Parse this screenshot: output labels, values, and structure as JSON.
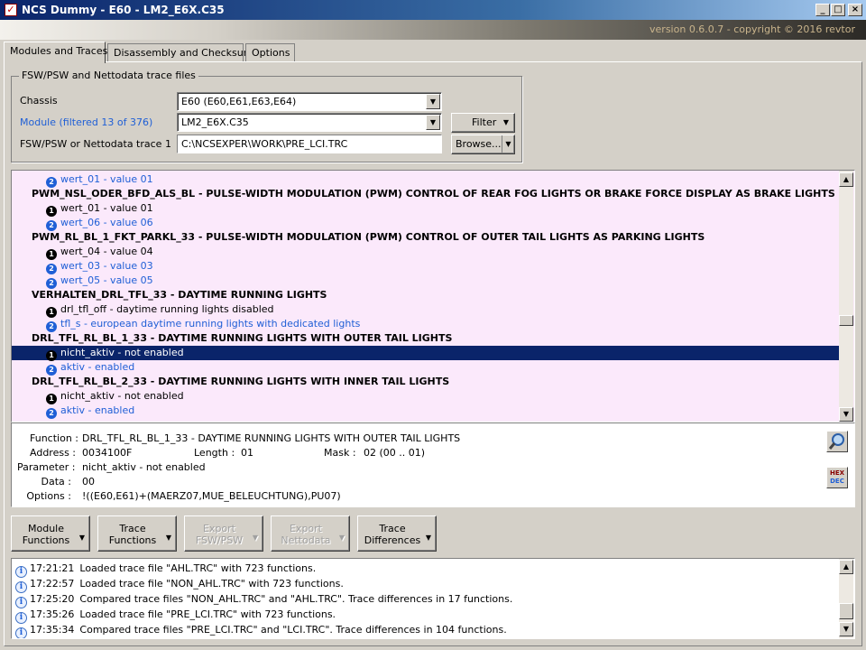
{
  "window": {
    "title": "NCS Dummy - E60 - LM2_E6X.C35",
    "version": "version 0.6.0.7 - copyright © 2016 revtor"
  },
  "tabs": [
    "Modules and Traces",
    "Disassembly and Checksums",
    "Options"
  ],
  "files": {
    "legend": "FSW/PSW and Nettodata trace files",
    "chassis_label": "Chassis",
    "chassis_value": "E60  (E60,E61,E63,E64)",
    "module_label": "Module (filtered 13 of 376)",
    "module_value": "LM2_E6X.C35",
    "trace_label": "FSW/PSW or Nettodata trace 1",
    "trace_value": "C:\\NCSEXPER\\WORK\\PRE_LCI.TRC",
    "filter_button": "Filter",
    "browse_button": "Browse..."
  },
  "functions": [
    {
      "kind": "value",
      "n": "2",
      "text": "wert_01  -  value 01"
    },
    {
      "kind": "header",
      "text": "PWM_NSL_ODER_BFD_ALS_BL  -  PULSE-WIDTH MODULATION (PWM) CONTROL OF REAR FOG LIGHTS OR BRAKE FORCE DISPLAY AS BRAKE LIGHTS"
    },
    {
      "kind": "value",
      "n": "1",
      "text": "wert_01  -  value 01"
    },
    {
      "kind": "value",
      "n": "2",
      "text": "wert_06  -  value 06"
    },
    {
      "kind": "header",
      "text": "PWM_RL_BL_1_FKT_PARKL_33  -  PULSE-WIDTH MODULATION (PWM) CONTROL OF OUTER TAIL LIGHTS AS PARKING LIGHTS"
    },
    {
      "kind": "value",
      "n": "1",
      "text": "wert_04  -  value 04"
    },
    {
      "kind": "value",
      "n": "2",
      "text": "wert_03  -  value 03"
    },
    {
      "kind": "value",
      "n": "2",
      "text": "wert_05  -  value 05"
    },
    {
      "kind": "header",
      "text": "VERHALTEN_DRL_TFL_33  -  DAYTIME RUNNING LIGHTS"
    },
    {
      "kind": "value",
      "n": "1",
      "text": "drl_tfl_off  -  daytime running lights disabled"
    },
    {
      "kind": "value",
      "n": "2",
      "text": "tfl_s  -  european daytime running lights with dedicated lights"
    },
    {
      "kind": "header",
      "text": "DRL_TFL_RL_BL_1_33  -  DAYTIME RUNNING LIGHTS WITH OUTER TAIL LIGHTS"
    },
    {
      "kind": "value",
      "n": "1",
      "text": "nicht_aktiv  -  not enabled",
      "selected": true
    },
    {
      "kind": "value",
      "n": "2",
      "text": "aktiv  -  enabled"
    },
    {
      "kind": "header",
      "text": "DRL_TFL_RL_BL_2_33  -  DAYTIME RUNNING LIGHTS WITH INNER TAIL LIGHTS"
    },
    {
      "kind": "value",
      "n": "1",
      "text": "nicht_aktiv  -  not enabled"
    },
    {
      "kind": "value",
      "n": "2",
      "text": "aktiv  -  enabled"
    }
  ],
  "details": {
    "function_label": "Function :",
    "function_value": "DRL_TFL_RL_BL_1_33  -  DAYTIME RUNNING LIGHTS WITH OUTER TAIL LIGHTS",
    "address_label": "Address :",
    "address_value": "0034100F",
    "length_label": "Length :",
    "length_value": "01",
    "mask_label": "Mask :",
    "mask_value": "02  (00 .. 01)",
    "parameter_label": "Parameter :",
    "parameter_value": "nicht_aktiv  -  not enabled",
    "data_label": "Data :",
    "data_value": "00",
    "options_label": "Options :",
    "options_value": "!((E60,E61)+(MAERZ07,MUE_BELEUCHTUNG),PU07)",
    "hex_icon_top": "HEX",
    "hex_icon_bottom": "DEC"
  },
  "actions": [
    {
      "l1": "Module",
      "l2": "Functions",
      "enabled": true
    },
    {
      "l1": "Trace",
      "l2": "Functions",
      "enabled": true
    },
    {
      "l1": "Export",
      "l2": "FSW/PSW",
      "enabled": false
    },
    {
      "l1": "Export",
      "l2": "Nettodata",
      "enabled": false
    },
    {
      "l1": "Trace",
      "l2": "Differences",
      "enabled": true
    }
  ],
  "log": [
    {
      "time": "17:21:21",
      "text": "Loaded trace file \"AHL.TRC\" with 723 functions."
    },
    {
      "time": "17:22:57",
      "text": "Loaded trace file \"NON_AHL.TRC\" with 723 functions."
    },
    {
      "time": "17:25:20",
      "text": "Compared trace files \"NON_AHL.TRC\" and \"AHL.TRC\". Trace differences in 17 functions."
    },
    {
      "time": "17:35:26",
      "text": "Loaded trace file \"PRE_LCI.TRC\" with 723 functions."
    },
    {
      "time": "17:35:34",
      "text": "Compared trace files \"PRE_LCI.TRC\" and \"LCI.TRC\". Trace differences in 104 functions."
    }
  ],
  "colors": {
    "selection": "#0a246a",
    "list_bg": "#fbe9fb",
    "accent_blue": "#1f5fd6"
  }
}
